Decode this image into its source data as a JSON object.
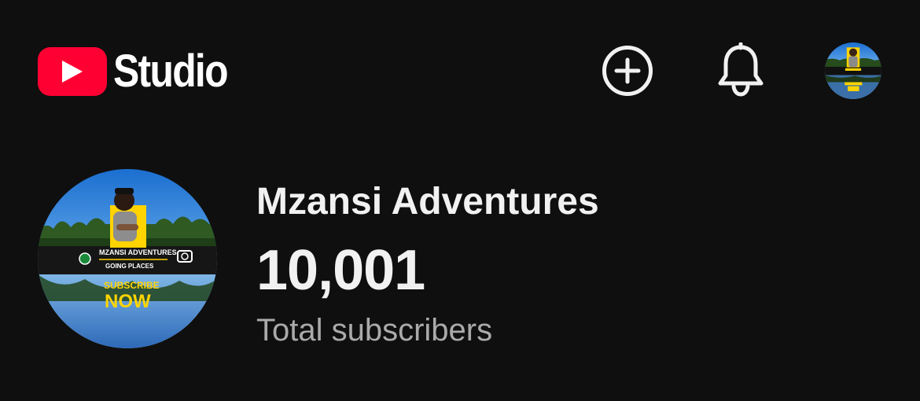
{
  "header": {
    "app_name": "Studio",
    "create_icon": "add-circle-icon",
    "notifications_icon": "bell-icon",
    "account_avatar": "channel-avatar"
  },
  "channel": {
    "name": "Mzansi Adventures",
    "subscriber_count": "10,001",
    "subscriber_label": "Total subscribers",
    "avatar_text": {
      "banner": "MZANSI ADVENTURES",
      "tagline": "GOING PLACES",
      "cta_top": "SUBSCRIBE",
      "cta_bottom": "NOW"
    }
  },
  "colors": {
    "background": "#0f0f0f",
    "brand_red": "#ff0033",
    "text_primary": "#f1f1f1",
    "text_secondary": "#aaaaaa",
    "highlight_yellow": "#ffd400"
  }
}
